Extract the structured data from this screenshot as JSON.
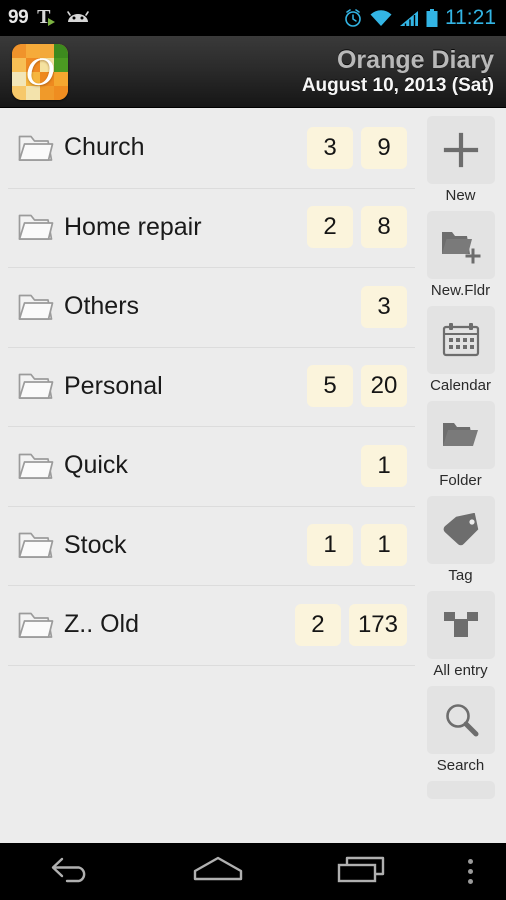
{
  "statusbar": {
    "notification_count": "99",
    "t_glyph": "T",
    "time": "11:21",
    "icons_left": [
      "tasker-icon",
      "android-robot-icon"
    ],
    "icons_right": [
      "alarm-clock-icon",
      "wifi-icon",
      "signal-icon",
      "battery-icon"
    ],
    "accent_color": "#33b5e5"
  },
  "titlebar": {
    "app_name": "Orange Diary",
    "date": "August 10, 2013 (Sat)",
    "icon_letter": "O"
  },
  "folders": [
    {
      "name": "Church",
      "badges": [
        "3",
        "9"
      ]
    },
    {
      "name": "Home repair",
      "badges": [
        "2",
        "8"
      ]
    },
    {
      "name": "Others",
      "badges": [
        "3"
      ]
    },
    {
      "name": "Personal",
      "badges": [
        "5",
        "20"
      ]
    },
    {
      "name": "Quick",
      "badges": [
        "1"
      ]
    },
    {
      "name": "Stock",
      "badges": [
        "1",
        "1"
      ]
    },
    {
      "name": "Z.. Old",
      "badges": [
        "2",
        "173"
      ]
    }
  ],
  "badge_color": "#fbf4dc",
  "toolbar": [
    {
      "label": "New",
      "icon": "plus-icon"
    },
    {
      "label": "New.Fldr",
      "icon": "folder-plus-icon"
    },
    {
      "label": "Calendar",
      "icon": "calendar-icon"
    },
    {
      "label": "Folder",
      "icon": "folder-icon"
    },
    {
      "label": "Tag",
      "icon": "tag-icon"
    },
    {
      "label": "All entry",
      "icon": "all-entry-icon"
    },
    {
      "label": "Search",
      "icon": "search-icon"
    }
  ],
  "navbar": {
    "back": "back-icon",
    "home": "home-icon",
    "recents": "recents-icon",
    "overflow": "overflow-menu-icon"
  }
}
